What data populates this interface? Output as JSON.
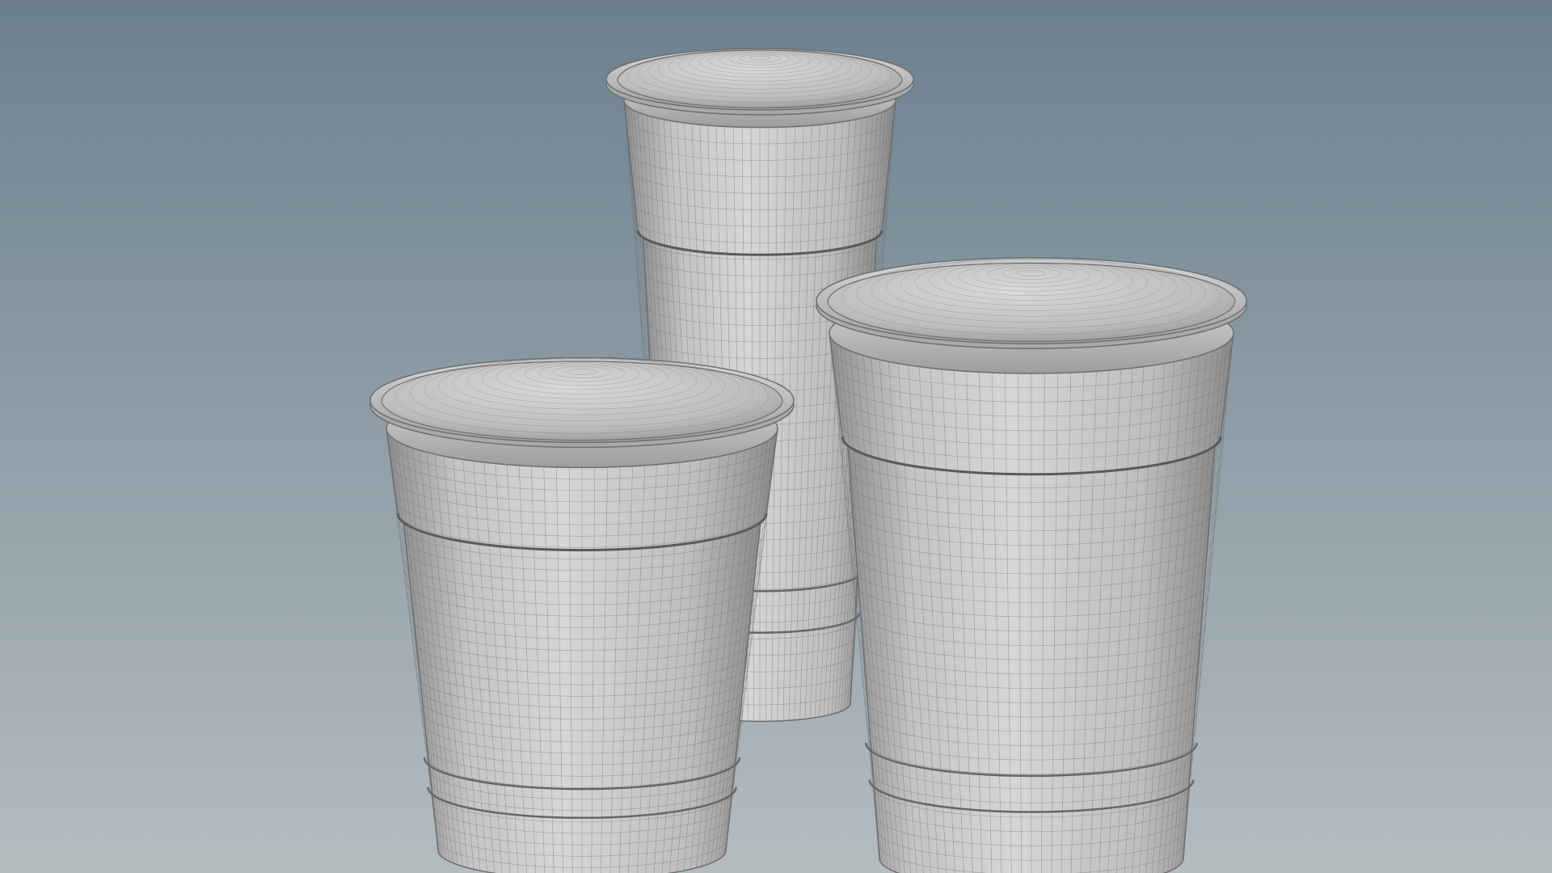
{
  "scene": {
    "render_style": "wireframe-shaded",
    "background_top_color": "#6b808f",
    "background_bottom_color": "#b4bcc0",
    "surface_color": "#c9c9c9",
    "wire_color": "#6e6e6e",
    "objects": [
      {
        "name": "cup-back-tall",
        "type": "cup-with-domed-lid"
      },
      {
        "name": "cup-front-left",
        "type": "cup-with-domed-lid"
      },
      {
        "name": "cup-front-right",
        "type": "cup-with-domed-lid"
      }
    ]
  }
}
